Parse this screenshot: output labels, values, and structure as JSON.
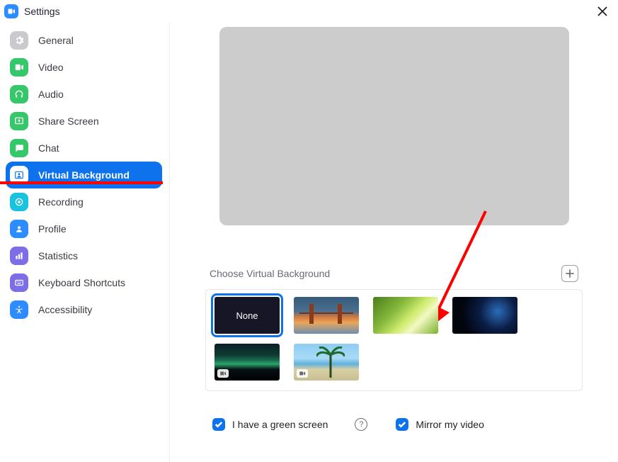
{
  "window": {
    "title": "Settings"
  },
  "sidebar": {
    "items": [
      {
        "label": "General",
        "color": "#c9c9cf"
      },
      {
        "label": "Video",
        "color": "#36c76a"
      },
      {
        "label": "Audio",
        "color": "#36c76a"
      },
      {
        "label": "Share Screen",
        "color": "#36c76a"
      },
      {
        "label": "Chat",
        "color": "#36c76a"
      },
      {
        "label": "Virtual Background",
        "color": "#0E72ED"
      },
      {
        "label": "Recording",
        "color": "#19c3dd"
      },
      {
        "label": "Profile",
        "color": "#2D8CFF"
      },
      {
        "label": "Statistics",
        "color": "#7b6ee6"
      },
      {
        "label": "Keyboard Shortcuts",
        "color": "#7b6ee6"
      },
      {
        "label": "Accessibility",
        "color": "#2D8CFF"
      }
    ],
    "active_index": 5
  },
  "virtual_background": {
    "section_title": "Choose Virtual Background",
    "selected_index": 0,
    "thumbs": [
      {
        "kind": "none",
        "label": "None"
      },
      {
        "kind": "bridge",
        "label": "Golden Gate Bridge"
      },
      {
        "kind": "grass",
        "label": "Grass"
      },
      {
        "kind": "earth",
        "label": "Earth from space"
      },
      {
        "kind": "aurora",
        "label": "Aurora",
        "is_video": true
      },
      {
        "kind": "beach",
        "label": "Beach with palm",
        "is_video": true
      }
    ],
    "options": {
      "green_screen": {
        "label": "I have a green screen",
        "checked": true
      },
      "mirror": {
        "label": "Mirror my video",
        "checked": true
      }
    }
  }
}
